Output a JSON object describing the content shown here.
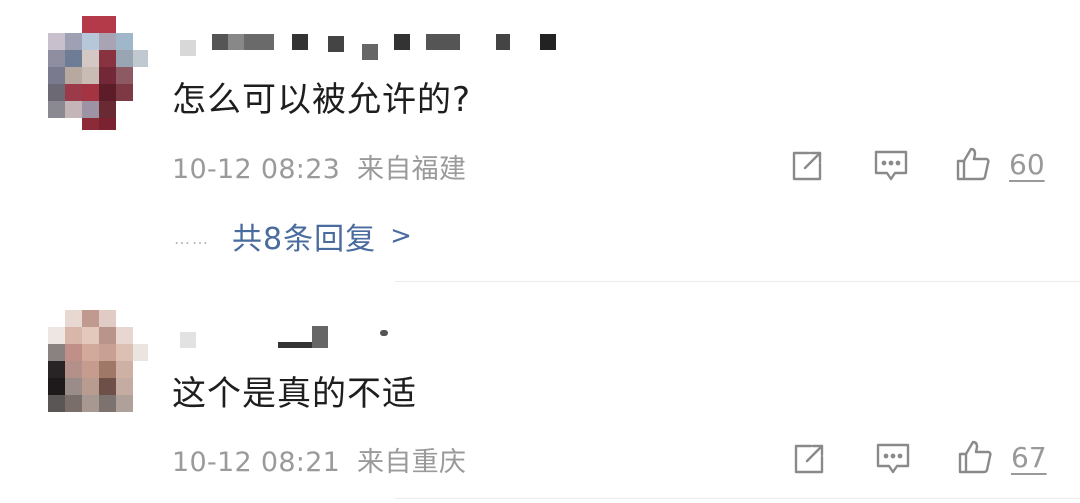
{
  "comments": [
    {
      "text": "怎么可以被允许的?",
      "time": "10-12 08:23",
      "location": "来自福建",
      "likes": "60",
      "replies_label": "共8条回复",
      "replies_chevron": ">",
      "replies_dots": "……"
    },
    {
      "text": "这个是真的不适",
      "time": "10-12 08:21",
      "location": "来自重庆",
      "likes": "67"
    }
  ],
  "icons": {
    "share": "share-icon",
    "comment": "comment-icon",
    "like": "thumbs-up-icon"
  },
  "colors": {
    "link": "#4a6b9e",
    "meta": "#9a9a9a",
    "text": "#1e1e1e",
    "icon": "#8a8a8a"
  }
}
